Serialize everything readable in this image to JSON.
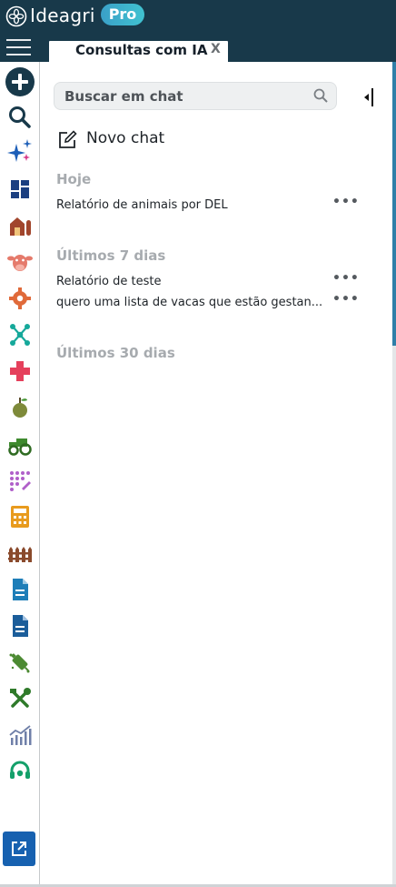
{
  "app": {
    "brand": "Ideagri",
    "badge": "Pro"
  },
  "tab": {
    "label": "Consultas com IA",
    "close": "X"
  },
  "search": {
    "placeholder": "Buscar em chat"
  },
  "new_chat": {
    "label": "Novo chat"
  },
  "groups": [
    {
      "label": "Hoje",
      "items": [
        {
          "title": "Relatório de animais por DEL",
          "menu": "•••"
        }
      ]
    },
    {
      "label": "Últimos 7 dias",
      "items": [
        {
          "title": "Relatório de teste",
          "menu": "•••"
        },
        {
          "title": "quero uma lista de vacas que estão gestan...",
          "menu": "•••"
        }
      ]
    },
    {
      "label": "Últimos 30 dias",
      "items": []
    }
  ],
  "sidebar": {
    "icons": [
      "add-icon",
      "search-icon",
      "sparkle-icon",
      "dashboard-icon",
      "barn-icon",
      "cow-icon",
      "settings-icon",
      "network-icon",
      "health-cross-icon",
      "apple-icon",
      "tractor-icon",
      "dots-pattern-icon",
      "calculator-icon",
      "fence-icon",
      "document-icon",
      "report-icon",
      "vaccine-icon",
      "tools-icon",
      "chart-icon",
      "headset-icon",
      "external-link-icon"
    ]
  },
  "colors": {
    "header": "#18394a",
    "accent": "#1761b0",
    "pro_badge": "#40c2d0",
    "scroll_thumb": "#2f7fa8"
  }
}
